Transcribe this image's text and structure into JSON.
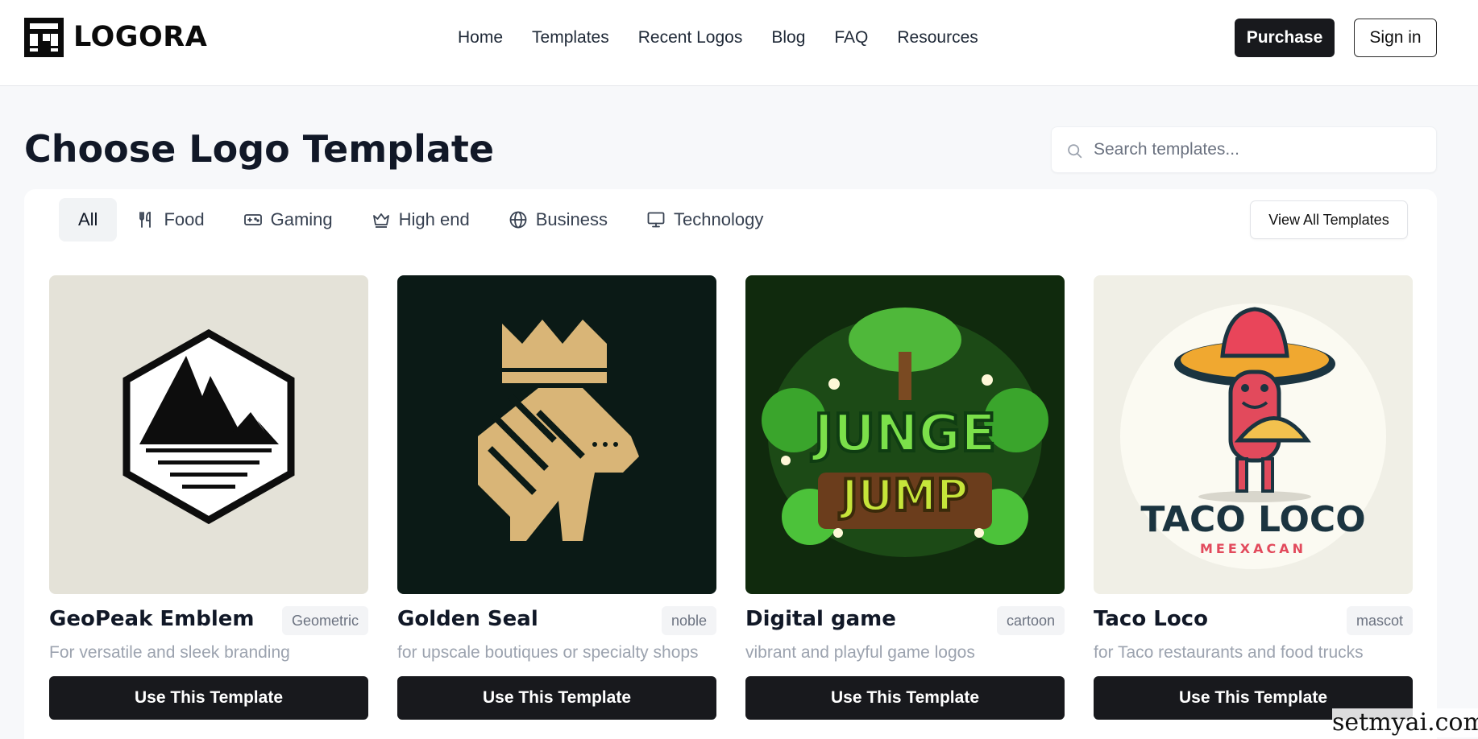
{
  "header": {
    "logo_text": "LOGORA",
    "nav": [
      "Home",
      "Templates",
      "Recent Logos",
      "Blog",
      "FAQ",
      "Resources"
    ],
    "purchase_label": "Purchase",
    "signin_label": "Sign in"
  },
  "page": {
    "title": "Choose Logo Template",
    "search_placeholder": "Search templates..."
  },
  "tabs": [
    {
      "label": "All",
      "icon": "grid-icon",
      "active": true
    },
    {
      "label": "Food",
      "icon": "utensils-icon"
    },
    {
      "label": "Gaming",
      "icon": "gamepad-icon"
    },
    {
      "label": "High end",
      "icon": "crown-icon"
    },
    {
      "label": "Business",
      "icon": "globe-icon"
    },
    {
      "label": "Technology",
      "icon": "monitor-icon"
    }
  ],
  "view_all_label": "View All Templates",
  "cards": [
    {
      "name": "GeoPeak Emblem",
      "tag": "Geometric",
      "desc": "For versatile and sleek branding",
      "button": "Use This Template",
      "image": "mountain-hexagon-emblem"
    },
    {
      "name": "Golden Seal",
      "tag": "noble",
      "desc": "for upscale boutiques or specialty shops",
      "button": "Use This Template",
      "image": "golden-lion-crown"
    },
    {
      "name": "Digital game",
      "tag": "cartoon",
      "desc": "vibrant and playful game logos",
      "button": "Use This Template",
      "image": "jungle-jump-game",
      "image_text": [
        "JUNGE",
        "JUMP"
      ]
    },
    {
      "name": "Taco Loco",
      "tag": "mascot",
      "desc": "for Taco restaurants and food trucks",
      "button": "Use This Template",
      "image": "taco-mascot-sombrero",
      "image_text": [
        "TACO LOCO",
        "MEEXACAN"
      ]
    }
  ],
  "watermark": "setmyai.com",
  "colors": {
    "primary_button": "#18191d",
    "background": "#f7f8fa"
  }
}
